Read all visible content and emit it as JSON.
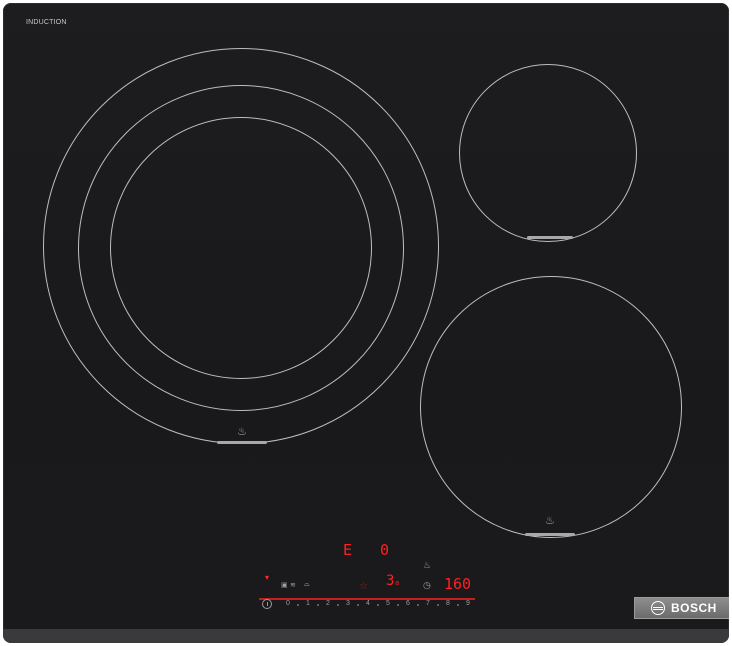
{
  "brand": {
    "series_label": "INDUCTION",
    "brand_name": "BOSCH"
  },
  "zones": {
    "large_zone_display": "E",
    "large_zone_level": "0",
    "small_zone_display": "3",
    "small_zone_suffix": "a"
  },
  "timer": {
    "display": "160"
  },
  "slider": {
    "levels": [
      "0",
      "1",
      "2",
      "3",
      "4",
      "5",
      "6",
      "7",
      "8",
      "9"
    ]
  },
  "icons": {
    "pot_icon": "pot-icon",
    "power_icon": "power-icon",
    "wifi_icon": "wifi-icon",
    "timer_icon": "clock-icon",
    "favorite_icon": "star-icon"
  },
  "colors": {
    "glass": "#1b1b1d",
    "rings": "#bdbdbd",
    "display_red": "#ff2020",
    "badge": "#7c7c7c"
  }
}
